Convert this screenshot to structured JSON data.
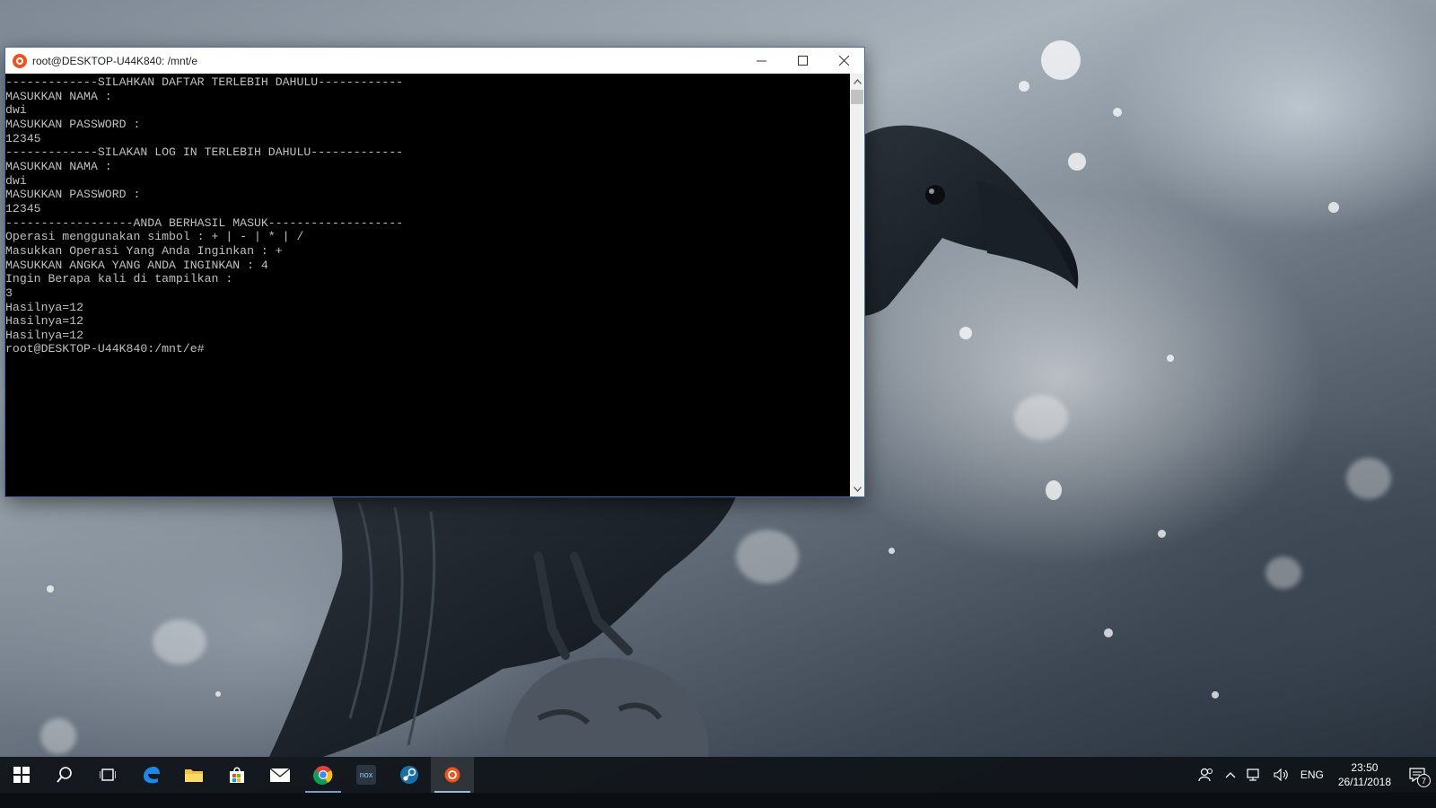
{
  "window": {
    "title": "root@DESKTOP-U44K840: /mnt/e",
    "minimize_icon": "minimize-icon",
    "maximize_icon": "maximize-icon",
    "close_icon": "close-icon"
  },
  "terminal": {
    "lines": [
      "-------------SILAHKAN DAFTAR TERLEBIH DAHULU------------",
      "MASUKKAN NAMA :",
      "dwi",
      "MASUKKAN PASSWORD :",
      "12345",
      "-------------SILAKAN LOG IN TERLEBIH DAHULU-------------",
      "MASUKKAN NAMA :",
      "dwi",
      "MASUKKAN PASSWORD :",
      "12345",
      "------------------ANDA BERHASIL MASUK-------------------",
      "Operasi menggunakan simbol : + | - | * | /",
      "Masukkan Operasi Yang Anda Inginkan : +",
      "MASUKKAN ANGKA YANG ANDA INGINKAN : 4",
      "Ingin Berapa kali di tampilkan :",
      "3",
      "Hasilnya=12",
      "Hasilnya=12",
      "Hasilnya=12",
      "root@DESKTOP-U44K840:/mnt/e#"
    ]
  },
  "taskbar": {
    "items": [
      "start-icon",
      "search-icon",
      "task-view-icon",
      "edge-icon",
      "file-explorer-icon",
      "store-icon",
      "mail-icon",
      "chrome-icon",
      "nox-icon",
      "steam-icon",
      "ubuntu-icon"
    ],
    "nox_label": "nox",
    "tray": {
      "language": "ENG",
      "time": "23:50",
      "date": "26/11/2018",
      "notification_count": "7"
    }
  }
}
